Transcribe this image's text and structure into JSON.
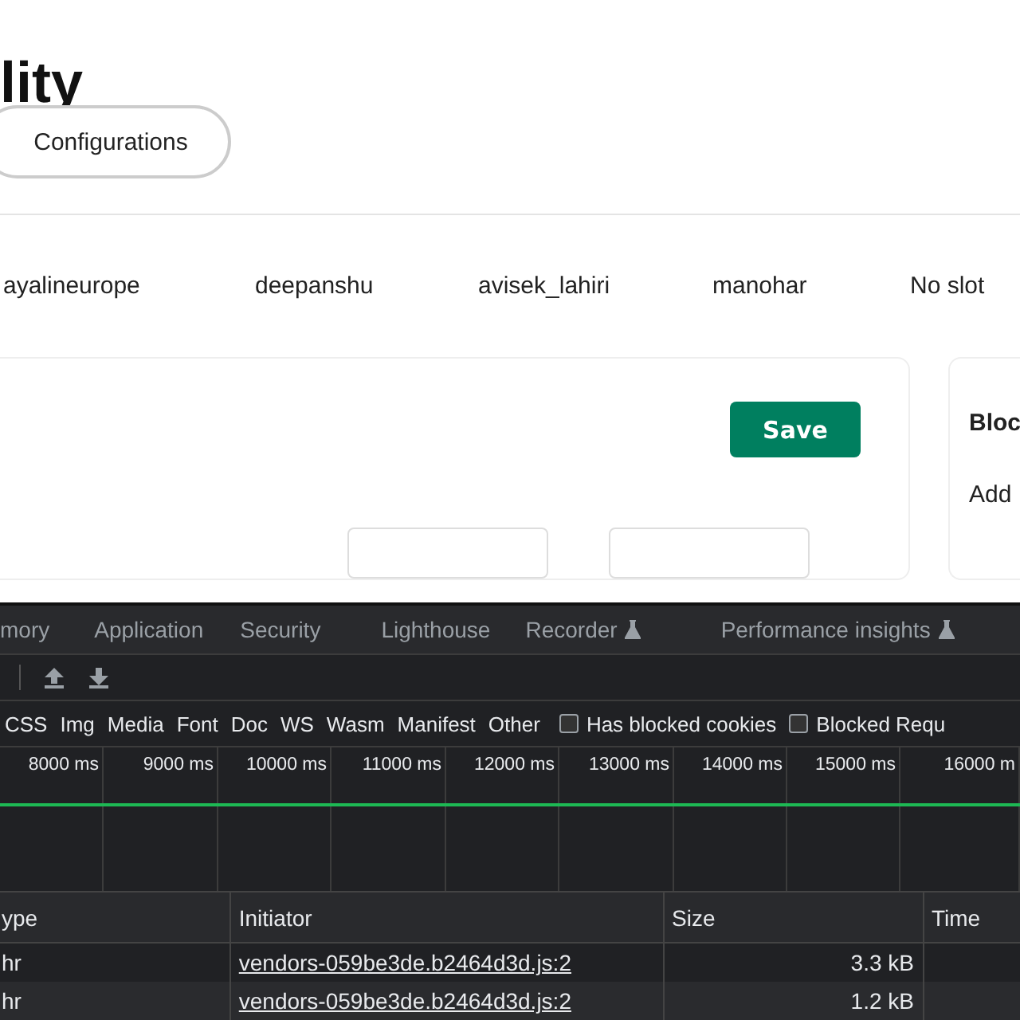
{
  "page": {
    "title": "lity",
    "config_button": "Configurations",
    "names": [
      "ayalineurope",
      "deepanshu",
      "avisek_lahiri",
      "manohar",
      "No slot"
    ]
  },
  "main_card": {
    "save_button": "Save"
  },
  "side_card": {
    "title": "Bloc",
    "text": "Add"
  },
  "devtools": {
    "tabs": [
      {
        "label": "mory",
        "selected": false,
        "experimental": false
      },
      {
        "label": "Application",
        "selected": false,
        "experimental": false
      },
      {
        "label": "Security",
        "selected": false,
        "experimental": false
      },
      {
        "label": "Lighthouse",
        "selected": false,
        "experimental": false
      },
      {
        "label": "Recorder",
        "selected": false,
        "experimental": true
      },
      {
        "label": "Performance insights",
        "selected": false,
        "experimental": true
      }
    ],
    "filters": [
      {
        "label": "CSS",
        "selected": false
      },
      {
        "label": "Img",
        "selected": false
      },
      {
        "label": "Media",
        "selected": false
      },
      {
        "label": "Font",
        "selected": false
      },
      {
        "label": "Doc",
        "selected": false
      },
      {
        "label": "WS",
        "selected": false
      },
      {
        "label": "Wasm",
        "selected": false
      },
      {
        "label": "Manifest",
        "selected": false
      },
      {
        "label": "Other",
        "selected": false
      }
    ],
    "options": [
      {
        "label": "Has blocked cookies",
        "checked": false
      },
      {
        "label": "Blocked Requ",
        "checked": false
      }
    ],
    "ticks": [
      "8000 ms",
      "9000 ms",
      "10000 ms",
      "11000 ms",
      "12000 ms",
      "13000 ms",
      "14000 ms",
      "15000 ms",
      "16000 m"
    ],
    "table": {
      "columns": [
        "ype",
        "Initiator",
        "Size",
        "Time"
      ],
      "rows": [
        {
          "type": "hr",
          "initiator": "vendors-059be3de.b2464d3d.js:2",
          "size": "3.3 kB",
          "time": ""
        },
        {
          "type": "hr",
          "initiator": "vendors-059be3de.b2464d3d.js:2",
          "size": "1.2 kB",
          "time": ""
        }
      ]
    }
  }
}
